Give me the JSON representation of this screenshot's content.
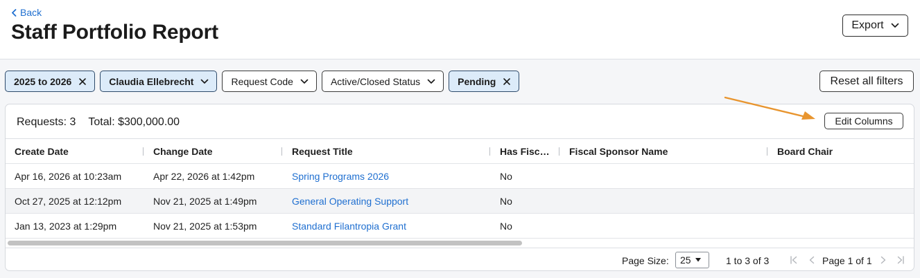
{
  "header": {
    "back_label": "Back",
    "title": "Staff Portfolio Report",
    "export_label": "Export"
  },
  "filters": {
    "chips": [
      {
        "label": "2025 to 2026",
        "active": true,
        "control": "remove"
      },
      {
        "label": "Claudia Ellebrecht",
        "active": true,
        "control": "dropdown"
      },
      {
        "label": "Request Code",
        "active": false,
        "control": "dropdown"
      },
      {
        "label": "Active/Closed Status",
        "active": false,
        "control": "dropdown"
      },
      {
        "label": "Pending",
        "active": true,
        "control": "remove"
      }
    ],
    "reset_label": "Reset all filters"
  },
  "summary": {
    "requests_label": "Requests: 3",
    "total_label": "Total: $300,000.00",
    "edit_columns_label": "Edit Columns"
  },
  "table": {
    "columns": [
      "Create Date",
      "Change Date",
      "Request Title",
      "Has Fisc…",
      "Fiscal Sponsor Name",
      "Board Chair"
    ],
    "rows": [
      [
        "Apr 16, 2026 at 10:23am",
        "Apr 22, 2026 at 1:42pm",
        "Spring Programs 2026",
        "No",
        "",
        ""
      ],
      [
        "Oct 27, 2025 at 12:12pm",
        "Nov 21, 2025 at 1:49pm",
        "General Operating Support",
        "No",
        "",
        ""
      ],
      [
        "Jan 13, 2023 at 1:29pm",
        "Nov 21, 2025 at 1:53pm",
        "Standard Filantropia Grant",
        "No",
        "",
        ""
      ]
    ]
  },
  "pager": {
    "page_size_label": "Page Size:",
    "page_size_value": "25",
    "range_label": "1 to 3 of 3",
    "page_label": "Page 1 of 1"
  },
  "colors": {
    "link": "#1f6fd0",
    "active_chip_bg": "#dcebf9",
    "annotation_arrow": "#e8952f"
  },
  "icons": {
    "back": "chevron-left-icon",
    "dropdown": "chevron-down-icon",
    "remove": "close-icon",
    "first_page": "first-page-icon",
    "prev_page": "prev-page-icon",
    "next_page": "next-page-icon",
    "last_page": "last-page-icon"
  }
}
